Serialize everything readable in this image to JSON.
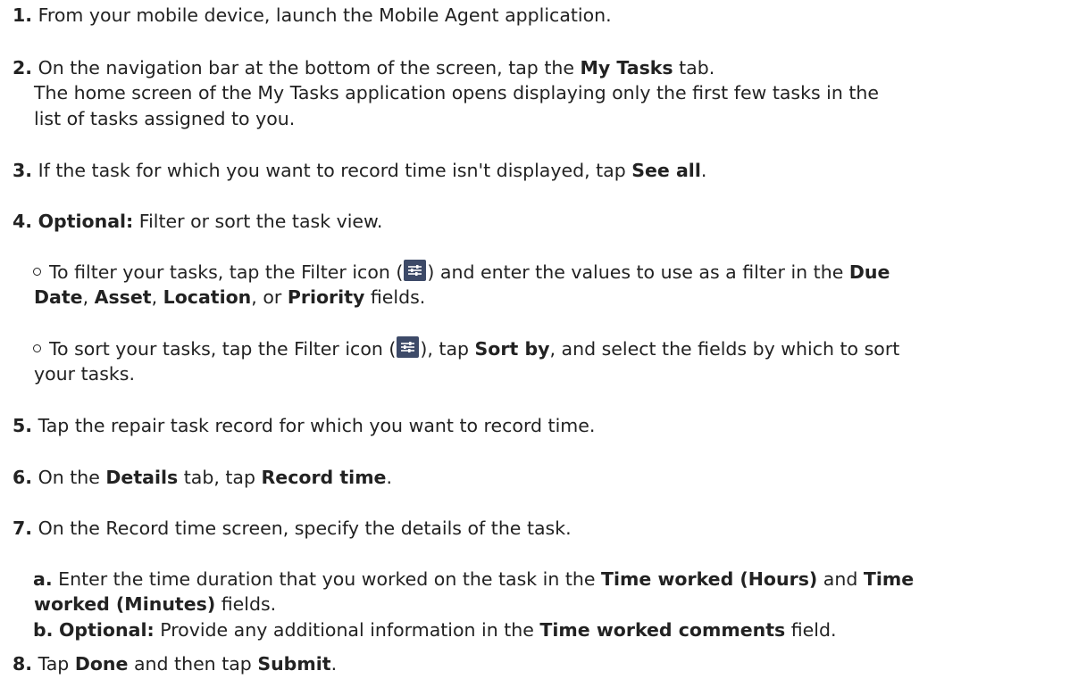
{
  "steps": [
    {
      "num": "1.",
      "parts": [
        "From your mobile device, launch the Mobile Agent application."
      ]
    },
    {
      "num": "2.",
      "parts": [
        "On the navigation bar at the bottom of the screen, tap the ",
        "My Tasks",
        " tab."
      ],
      "result_line1": "The home screen of the My Tasks application opens displaying only the first few tasks in the",
      "result_line2": "list of tasks assigned to you."
    },
    {
      "num": "3.",
      "parts": [
        "If the task for which you want to record time isn't displayed, tap ",
        "See all",
        "."
      ]
    },
    {
      "num": "4.",
      "parts": [
        "Optional:",
        " Filter or sort the task view."
      ],
      "bullets": [
        {
          "line1_parts": [
            "To filter your tasks, tap the Filter icon (",
            ") and enter the values to use as a filter in the ",
            "Due"
          ],
          "line2_parts": [
            "Date",
            ", ",
            "Asset",
            ", ",
            "Location",
            ", or ",
            "Priority",
            " fields."
          ]
        },
        {
          "line1_parts": [
            "To sort your tasks, tap the Filter icon (",
            "), tap ",
            "Sort by",
            ", and select the fields by which to sort"
          ],
          "line2_parts": [
            "your tasks."
          ]
        }
      ]
    },
    {
      "num": "5.",
      "parts": [
        "Tap the repair task record for which you want to record time."
      ]
    },
    {
      "num": "6.",
      "parts": [
        "On the ",
        "Details",
        " tab, tap ",
        "Record time",
        "."
      ]
    },
    {
      "num": "7.",
      "parts": [
        "On the Record time screen, specify the details of the task."
      ],
      "substeps": [
        {
          "letter": "a.",
          "line1_parts": [
            " Enter the time duration that you worked on the task in the ",
            "Time worked (Hours)",
            " and ",
            "Time"
          ],
          "line2_parts": [
            "worked (Minutes)",
            " fields."
          ]
        },
        {
          "letter": "b.",
          "line1_parts": [
            " ",
            "Optional:",
            " Provide any additional information in the ",
            "Time worked comments",
            " field."
          ]
        }
      ]
    },
    {
      "num": "8.",
      "parts": [
        "Tap ",
        "Done",
        " and then tap ",
        "Submit",
        "."
      ]
    }
  ],
  "icons": {
    "filter_icon_name": "filter-icon",
    "filter_icon_bg": "#3d4a68"
  }
}
